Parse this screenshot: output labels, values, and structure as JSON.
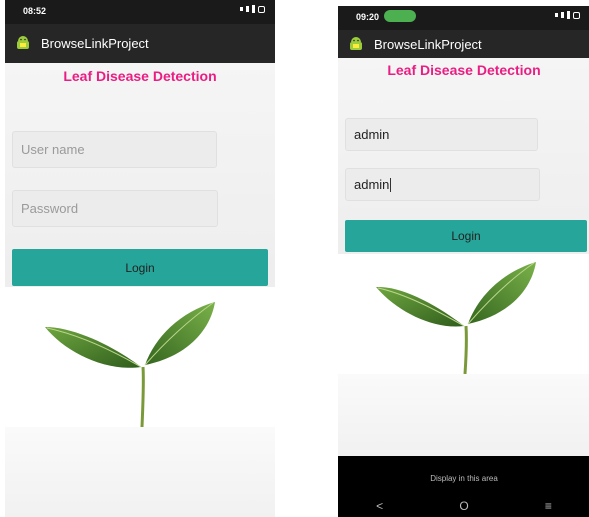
{
  "left": {
    "status_time": "08:52",
    "app_title": "BrowseLinkProject",
    "headline": "Leaf Disease Detection",
    "username_placeholder": "User name",
    "password_placeholder": "Password",
    "login_label": "Login"
  },
  "right": {
    "status_time": "09:20",
    "app_title": "BrowseLinkProject",
    "headline": "Leaf Disease Detection",
    "username_value": "admin",
    "password_value": "admin",
    "login_label": "Login",
    "display_text": "Display in this area",
    "nav_back": "<",
    "nav_home": "O",
    "nav_menu": "≡"
  },
  "colors": {
    "accent": "#26a69a",
    "headline": "#e91e83",
    "appbar": "#262626"
  },
  "icons": [
    "android-icon",
    "signal-icon",
    "wifi-icon",
    "battery-icon",
    "leaf-plant-illustration"
  ]
}
